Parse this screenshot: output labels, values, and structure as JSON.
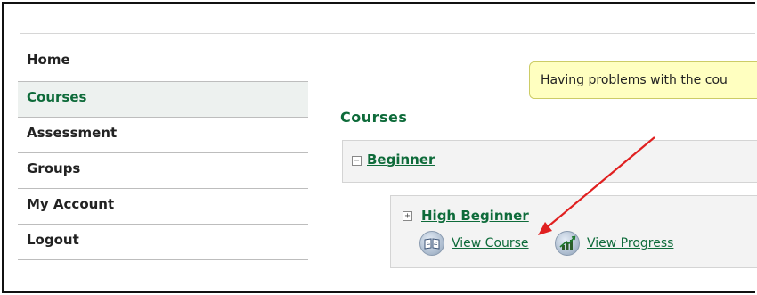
{
  "nav": {
    "items": [
      {
        "label": "Home"
      },
      {
        "label": "Courses"
      },
      {
        "label": "Assessment"
      },
      {
        "label": "Groups"
      },
      {
        "label": "My Account"
      },
      {
        "label": "Logout"
      }
    ],
    "active": "Courses"
  },
  "notice": {
    "text": "Having problems with the cou"
  },
  "main": {
    "title": "Courses",
    "courses": [
      {
        "name": "Beginner",
        "toggle": "−",
        "children": [
          {
            "name": "High Beginner",
            "toggle": "+",
            "actions": [
              {
                "label": "View Course",
                "icon": "book-icon"
              },
              {
                "label": "View Progress",
                "icon": "progress-chart-icon"
              }
            ]
          }
        ]
      }
    ]
  },
  "colors": {
    "accent_green": "#0e6b3a",
    "notice_bg": "#ffffc0",
    "annotation_arrow": "#e02020"
  }
}
